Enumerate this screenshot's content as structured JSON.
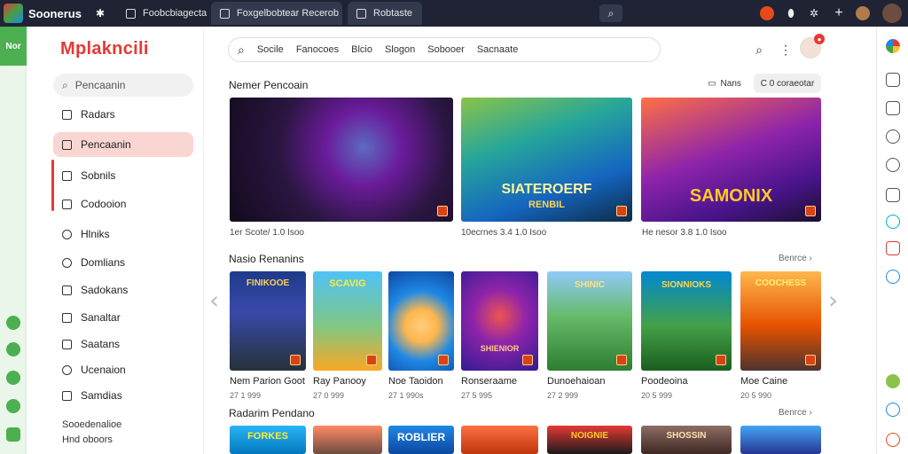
{
  "browser": {
    "app_title": "Soonerus",
    "tabs": [
      {
        "label": "Foobcbiagecta"
      },
      {
        "label": "Foxgelbobtear Recerob"
      },
      {
        "label": "Robtaste"
      }
    ],
    "rail_label": "Nor"
  },
  "sidebar": {
    "brand": "Mplakncili",
    "search_label": "Pencaanin",
    "items": [
      {
        "label": "Radars",
        "icon": "grid-icon"
      },
      {
        "label": "Pencaanin",
        "icon": "list-icon",
        "active": true
      },
      {
        "label": "Sobnils",
        "icon": "doc-icon"
      },
      {
        "label": "Codooion",
        "icon": "tag-icon"
      },
      {
        "label": "Hlniks",
        "icon": "circle-icon"
      },
      {
        "label": "Domlians",
        "icon": "circle-icon"
      },
      {
        "label": "Sadokans",
        "icon": "box-icon"
      },
      {
        "label": "Sanaltar",
        "icon": "chat-icon"
      },
      {
        "label": "Saatans",
        "icon": "cart-icon"
      },
      {
        "label": "Ucenaion",
        "icon": "circle-icon"
      },
      {
        "label": "Samdias",
        "icon": "grid-icon"
      }
    ],
    "footer": [
      "Sooedenalioe",
      "Hnd oboors"
    ]
  },
  "header": {
    "search_terms": [
      "Socile",
      "Fanocoes",
      "Blcio",
      "Slogon",
      "Sobooer",
      "Sacnaate"
    ]
  },
  "featured": {
    "title": "Nemer Pencoain",
    "chip_news": "Nans",
    "chip_sort": "C 0 coraeotar",
    "cards": [
      {
        "meta": "1er Scote/ 1.0 Isoo"
      },
      {
        "meta": "10ecrnes 3.4 1.0 Isoo"
      },
      {
        "meta": "He nesor 3.8 1.0 Isoo"
      }
    ],
    "art_titles": [
      "",
      "SIATEROERF",
      "SAMONIX"
    ],
    "art_subtitles": [
      "",
      "RENBIL",
      ""
    ]
  },
  "new_section": {
    "title": "Nasio Renanins",
    "more": "Benrce",
    "tiles": [
      {
        "name": "Nem Parion Goot",
        "meta": "27 1 999",
        "art_title": "FINIKOOE"
      },
      {
        "name": "Ray Panooy",
        "meta": "27 0 999",
        "art_title": "SCAVIG"
      },
      {
        "name": "Noe Taoidon",
        "meta": "27 1 990s",
        "art_title": ""
      },
      {
        "name": "Ronseraame",
        "meta": "27 5 995",
        "art_title": "SHIENIOR"
      },
      {
        "name": "Dunoehaioan",
        "meta": "27 2 999",
        "art_title": "SHINIC"
      },
      {
        "name": "Poodeoina",
        "meta": "20 5 999",
        "art_title": "SIONNIOKS"
      },
      {
        "name": "Moe Caine",
        "meta": "20 5 990",
        "art_title": "COOCHESS"
      }
    ]
  },
  "random_section": {
    "title": "Radarim Pendano",
    "more": "Benrce",
    "art_titles": [
      "FORKES",
      "",
      "ROBLIER",
      "",
      "NOIGNIE",
      "SHOSSIN",
      ""
    ]
  }
}
